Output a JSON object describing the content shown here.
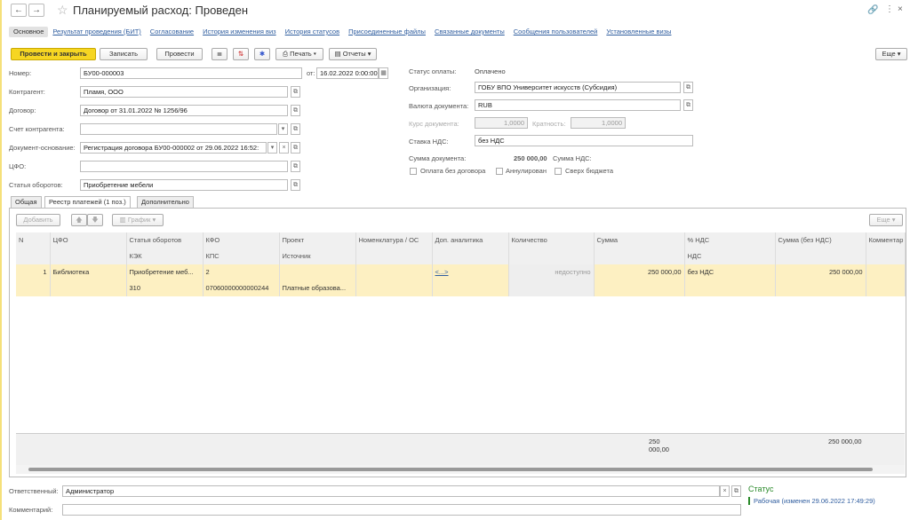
{
  "window": {
    "title": "Планируемый расход: Проведен",
    "back": "←",
    "fwd": "→"
  },
  "tabs": [
    "Основное",
    "Результат проведения (БИТ)",
    "Согласование",
    "История изменения виз",
    "История статусов",
    "Присоединенные файлы",
    "Связанные документы",
    "Сообщения пользователей",
    "Установленные визы"
  ],
  "toolbar": {
    "post_close": "Провести и закрыть",
    "write": "Записать",
    "post": "Провести",
    "print": "Печать",
    "reports": "Отчеты",
    "more": "Еще"
  },
  "form": {
    "number_label": "Номер:",
    "number": "БУ00-000003",
    "from_label": "от:",
    "date": "16.02.2022  0:00:00",
    "contractor_label": "Контрагент:",
    "contractor": "Пламя, ООО",
    "contract_label": "Договор:",
    "contract": "Договор от 31.01.2022 № 1256/96",
    "account_label": "Счет контрагента:",
    "account": "",
    "basis_label": "Документ-основание:",
    "basis": "Регистрация договора БУ00-000002 от 29.06.2022 16:52:",
    "cfo_label": "ЦФО:",
    "cfo": "",
    "article_label": "Статья оборотов:",
    "article": "Приобретение мебели",
    "paystatus_label": "Статус оплаты:",
    "paystatus": "Оплачено",
    "org_label": "Организация:",
    "org": "ГОБУ ВПО Университет искусств (Субсидия)",
    "currency_label": "Валюта документа:",
    "currency": "RUB",
    "rate_label": "Курс документа:",
    "rate": "1,0000",
    "mult_label": "Кратность:",
    "mult": "1,0000",
    "vat_rate_label": "Ставка НДС:",
    "vat_rate": "без НДС",
    "sum_label": "Сумма документа:",
    "sum": "250 000,00",
    "vat_sum_label": "Сумма НДС:",
    "cb1": "Оплата без договора",
    "cb2": "Аннулирован",
    "cb3": "Сверх бюджета"
  },
  "subtabs": [
    "Общая",
    "Реестр платежей (1 поз.)",
    "Дополнительно"
  ],
  "grid_toolbar": {
    "add": "Добавить",
    "chart": "График",
    "more": "Еще"
  },
  "table": {
    "head1": [
      "N",
      "ЦФО",
      "Статья оборотов",
      "КФО",
      "Проект",
      "Номенклатура / ОС",
      "Доп. аналитика",
      "Количество",
      "Сумма",
      "% НДС",
      "Сумма (без НДС)",
      "Комментар"
    ],
    "head2": [
      "",
      "",
      "КЭК",
      "КПС",
      "Источник",
      "",
      "",
      "",
      "",
      "НДС",
      "",
      ""
    ],
    "row1": [
      "1",
      "Библиотека",
      "Приобретение меб...",
      "2",
      "",
      "",
      "<...>",
      "недоступно",
      "250 000,00",
      "без НДС",
      "250 000,00",
      ""
    ],
    "row2": [
      "",
      "",
      "310",
      "07060000000000244",
      "Платные образова...",
      "",
      "",
      "",
      "",
      "",
      "",
      ""
    ],
    "totals": {
      "sum": "250 000,00",
      "sum_no_vat": "250 000,00"
    }
  },
  "footer": {
    "resp_label": "Ответственный:",
    "resp": "Администратор",
    "comment_label": "Комментарий:",
    "comment": "",
    "status_title": "Статус",
    "status": "Рабочая (изменен 29.06.2022 17:49:29)"
  }
}
